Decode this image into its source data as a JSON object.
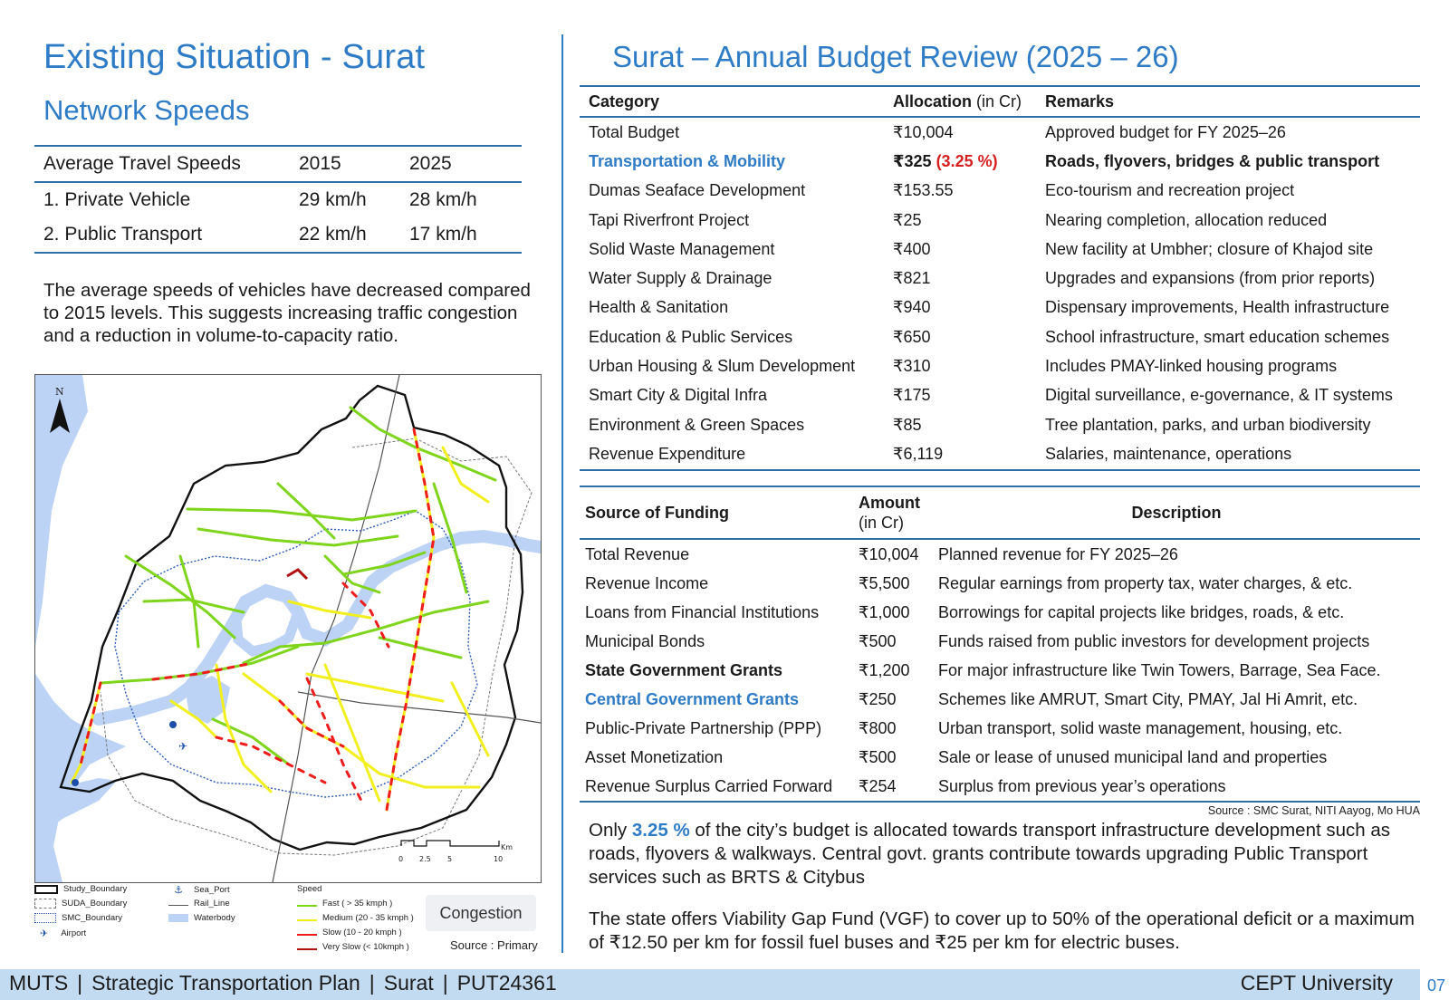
{
  "left": {
    "title": "Existing Situation - Surat",
    "subtitle": "Network Speeds",
    "speed_table": {
      "headers": [
        "Average Travel Speeds",
        "2015",
        "2025"
      ],
      "rows": [
        [
          "1. Private Vehicle",
          "29 km/h",
          "28 km/h"
        ],
        [
          "2. Public Transport",
          "22 km/h",
          "17 km/h"
        ]
      ]
    },
    "paragraph": "The average speeds of vehicles have decreased compared to 2015 levels. This suggests increasing traffic congestion and a reduction in volume-to-capacity ratio.",
    "map": {
      "north_label": "N",
      "scale_labels": [
        "0",
        "2.5",
        "5",
        "10"
      ],
      "scale_unit": "Km",
      "legend": {
        "study_boundary": "Study_Boundary",
        "suda_boundary": "SUDA_Boundary",
        "smc_boundary": "SMC_Boundary",
        "airport": "Airport",
        "sea_port": "Sea_Port",
        "rail_line": "Rail_Line",
        "waterbody": "Waterbody",
        "speed_title": "Speed",
        "fast": "Fast ( > 35 kmph )",
        "medium": "Medium (20 - 35 kmph )",
        "slow": "Slow (10 - 20 kmph )",
        "very_slow": "Very Slow (< 10kmph )"
      },
      "colors": {
        "fast": "#7fd41c",
        "medium": "#f2ef1e",
        "slow": "#ee1d1d",
        "very_slow": "#b01010",
        "water": "#bcd3f5",
        "rail": "#555555"
      },
      "badge": "Congestion",
      "source": "Source : Primary"
    }
  },
  "right": {
    "title": "Surat – Annual Budget Review (2025 – 26)",
    "budget_headers": {
      "category": "Category",
      "allocation": "Allocation",
      "allocation_unit": " (in Cr)",
      "remarks": "Remarks"
    },
    "budget_rows": [
      {
        "category": "Total Budget",
        "allocation": "₹10,004",
        "pct": "",
        "remarks": "Approved budget for FY 2025–26",
        "highlight": false
      },
      {
        "category": "Transportation & Mobility",
        "allocation": "₹325",
        "pct": " (3.25 %)",
        "remarks": "Roads, flyovers, bridges & public transport",
        "highlight": true
      },
      {
        "category": "Dumas Seaface Development",
        "allocation": "₹153.55",
        "pct": "",
        "remarks": "Eco-tourism and recreation project",
        "highlight": false
      },
      {
        "category": "Tapi Riverfront Project",
        "allocation": "₹25",
        "pct": "",
        "remarks": "Nearing completion, allocation reduced",
        "highlight": false
      },
      {
        "category": "Solid Waste Management",
        "allocation": "₹400",
        "pct": "",
        "remarks": "New facility at Umbher; closure of Khajod site",
        "highlight": false
      },
      {
        "category": "Water Supply & Drainage",
        "allocation": "₹821",
        "pct": "",
        "remarks": "Upgrades and expansions (from prior reports)",
        "highlight": false
      },
      {
        "category": "Health & Sanitation",
        "allocation": "₹940",
        "pct": "",
        "remarks": "Dispensary improvements, Health infrastructure",
        "highlight": false
      },
      {
        "category": "Education & Public Services",
        "allocation": "₹650",
        "pct": "",
        "remarks": "School infrastructure, smart education schemes",
        "highlight": false
      },
      {
        "category": "Urban Housing & Slum Development",
        "allocation": "₹310",
        "pct": "",
        "remarks": "Includes PMAY-linked housing programs",
        "highlight": false
      },
      {
        "category": "Smart City & Digital Infra",
        "allocation": "₹175",
        "pct": "",
        "remarks": "Digital surveillance, e-governance, & IT systems",
        "highlight": false
      },
      {
        "category": "Environment & Green Spaces",
        "allocation": "₹85",
        "pct": "",
        "remarks": "Tree plantation, parks, and urban biodiversity",
        "highlight": false
      },
      {
        "category": "Revenue Expenditure",
        "allocation": "₹6,119",
        "pct": "",
        "remarks": "Salaries, maintenance, operations",
        "highlight": false
      }
    ],
    "funding_headers": {
      "source": "Source of Funding",
      "amount": "Amount",
      "amount_unit": "(in Cr)",
      "description": "Description"
    },
    "funding_rows": [
      {
        "source": "Total Revenue",
        "amount": "₹10,004",
        "description": "Planned revenue for FY 2025–26",
        "style": "normal"
      },
      {
        "source": "Revenue Income",
        "amount": "₹5,500",
        "description": "Regular earnings from property tax, water charges, & etc.",
        "style": "normal"
      },
      {
        "source": "Loans from Financial Institutions",
        "amount": "₹1,000",
        "description": "Borrowings for capital projects like bridges, roads, & etc.",
        "style": "normal"
      },
      {
        "source": "Municipal Bonds",
        "amount": "₹500",
        "description": "Funds raised from public investors for development projects",
        "style": "normal"
      },
      {
        "source": "State Government Grants",
        "amount": "₹1,200",
        "description": "For major infrastructure like Twin Towers, Barrage, Sea Face.",
        "style": "bold"
      },
      {
        "source": "Central Government Grants",
        "amount": "₹250",
        "description": "Schemes like AMRUT, Smart City, PMAY, Jal Hi Amrit, etc.",
        "style": "blue"
      },
      {
        "source": "Public-Private Partnership (PPP)",
        "amount": "₹800",
        "description": "Urban transport, solid waste management, housing, etc.",
        "style": "normal"
      },
      {
        "source": "Asset Monetization",
        "amount": "₹500",
        "description": "Sale or lease of unused municipal land and properties",
        "style": "normal"
      },
      {
        "source": "Revenue Surplus Carried Forward",
        "amount": "₹254",
        "description": "Surplus from previous year’s operations",
        "style": "normal"
      }
    ],
    "source_note": "Source : SMC Surat, NITI Aayog, Mo HUA",
    "note1": {
      "pre": "Only ",
      "highlight": "3.25 %",
      "post": " of the city’s budget is allocated towards transport infrastructure development such as roads, flyovers & walkways. Central govt. grants contribute towards upgrading Public Transport services such as BRTS & Citybus"
    },
    "note2": "The state offers Viability Gap Fund (VGF) to cover up to 50% of the operational deficit or a maximum of ₹12.50 per km for fossil fuel buses and ₹25 per km for electric buses."
  },
  "footer": {
    "items": [
      "MUTS",
      "Strategic Transportation Plan",
      "Surat",
      "PUT24361"
    ],
    "separator": "|",
    "right": "CEPT University",
    "page": "07"
  },
  "theme": {
    "accent": "#2e7bc6",
    "rule": "#2e6fa8",
    "footer_bg": "#c3dbf1",
    "pct_red": "#d62020"
  }
}
